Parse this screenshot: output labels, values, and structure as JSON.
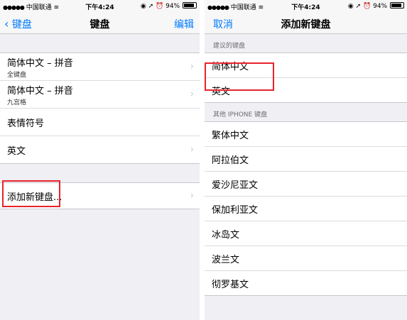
{
  "left": {
    "status": {
      "carrier": "中国联通",
      "time": "下午4:24",
      "battery": "94%"
    },
    "nav": {
      "back_label": "键盘",
      "title": "键盘",
      "edit_label": "编辑"
    },
    "keyboards": [
      {
        "title": "简体中文 – 拼音",
        "subtitle": "全键盘"
      },
      {
        "title": "简体中文 – 拼音",
        "subtitle": "九宫格"
      },
      {
        "title": "表情符号",
        "subtitle": ""
      },
      {
        "title": "英文",
        "subtitle": ""
      }
    ],
    "add_label": "添加新键盘..."
  },
  "right": {
    "status": {
      "carrier": "中国联通",
      "time": "下午4:24",
      "battery": "94%"
    },
    "nav": {
      "cancel_label": "取消",
      "title": "添加新键盘"
    },
    "suggested_header": "建议的键盘",
    "suggested": [
      "简体中文",
      "英文"
    ],
    "other_header": "其他 IPHONE 键盘",
    "other": [
      "繁体中文",
      "阿拉伯文",
      "爱沙尼亚文",
      "保加利亚文",
      "冰岛文",
      "波兰文",
      "彻罗基文"
    ]
  },
  "colors": {
    "accent": "#007aff",
    "highlight": "#e8242b"
  }
}
